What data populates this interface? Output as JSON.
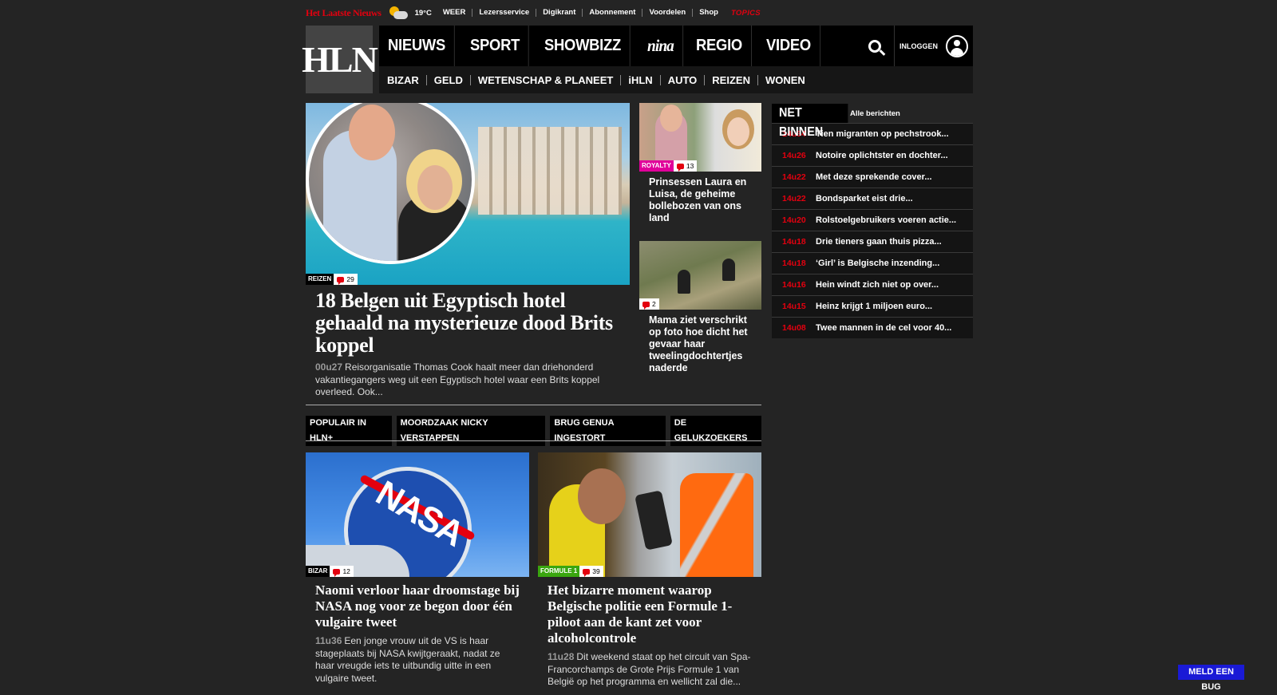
{
  "topbar": {
    "brand": "Het Laatste Nieuws",
    "temperature": "19°C",
    "links": [
      "WEER",
      "Lezersservice",
      "Digikrant",
      "Abonnement",
      "Voordelen",
      "Shop"
    ],
    "topics": "TOPICS"
  },
  "header": {
    "logo": "HLN",
    "nav_main": [
      "NIEUWS",
      "SPORT",
      "SHOWBIZZ",
      "nina",
      "REGIO",
      "VIDEO"
    ],
    "login": "INLOGGEN",
    "nav_sub": [
      "BIZAR",
      "GELD",
      "WETENSCHAP & PLANEET",
      "iHLN",
      "AUTO",
      "REIZEN",
      "WONEN"
    ]
  },
  "lead": {
    "tag": "REIZEN",
    "comments": "29",
    "title": "18 Belgen uit Egyptisch hotel gehaald na mysterieuze dood Brits koppel",
    "time": "00u27",
    "intro": "Reisorganisatie Thomas Cook haalt meer dan driehonderd vakantiegangers weg uit een Egyptisch hotel waar een Brits koppel overleed. Ook..."
  },
  "side": [
    {
      "tag": "ROYALTY",
      "comments": "13",
      "title": "Prinsessen Laura en Luisa, de geheime bollebozen van ons land"
    },
    {
      "comments": "2",
      "title": "Mama ziet verschrikt op foto hoe dicht het gevaar haar tweelingdochtertjes naderde"
    }
  ],
  "net_binnen": {
    "label": "NET BINNEN",
    "all": "Alle berichten",
    "items": [
      {
        "time": "14u34",
        "text": "Tien migranten op pechstrook..."
      },
      {
        "time": "14u26",
        "text": "Notoire oplichtster en dochter..."
      },
      {
        "time": "14u22",
        "text": "Met deze sprekende cover..."
      },
      {
        "time": "14u22",
        "text": "Bondsparket eist drie..."
      },
      {
        "time": "14u20",
        "text": "Rolstoelgebruikers voeren actie..."
      },
      {
        "time": "14u18",
        "text": "Drie tieners gaan thuis pizza..."
      },
      {
        "time": "14u18",
        "text": "‘Girl’ is Belgische inzending..."
      },
      {
        "time": "14u16",
        "text": "Hein windt zich niet op over..."
      },
      {
        "time": "14u15",
        "text": "Heinz krijgt 1 miljoen euro..."
      },
      {
        "time": "14u08",
        "text": "Twee mannen in de cel voor 40..."
      }
    ]
  },
  "popular": [
    "POPULAIR IN HLN+",
    "MOORDZAAK NICKY VERSTAPPEN",
    "BRUG GENUA INGESTORT",
    "DE GELUKZOEKERS"
  ],
  "cards": [
    {
      "tag": "BIZAR",
      "comments": "12",
      "title": "Naomi verloor haar droomstage bij NASA nog voor ze begon door één vulgaire tweet",
      "time": "11u36",
      "intro": "Een jonge vrouw uit de VS is haar stageplaats bij NASA kwijtgeraakt, nadat ze haar vreugde iets te uitbundig uitte in een vulgaire tweet."
    },
    {
      "tag": "FORMULE 1",
      "comments": "39",
      "title": "Het bizarre moment waarop Belgische politie een Formule 1-piloot aan de kant zet voor alcoholcontrole",
      "time": "11u28",
      "intro": "Dit weekend staat op het circuit van Spa-Francorchamps de Grote Prijs Formule 1 van België op het programma en wellicht zal die..."
    }
  ],
  "bug_button": "MELD EEN BUG",
  "colors": {
    "accent": "#e3000f",
    "royalty": "#e0009a",
    "f1": "#3aa60f",
    "bug": "#1a1ad6"
  }
}
